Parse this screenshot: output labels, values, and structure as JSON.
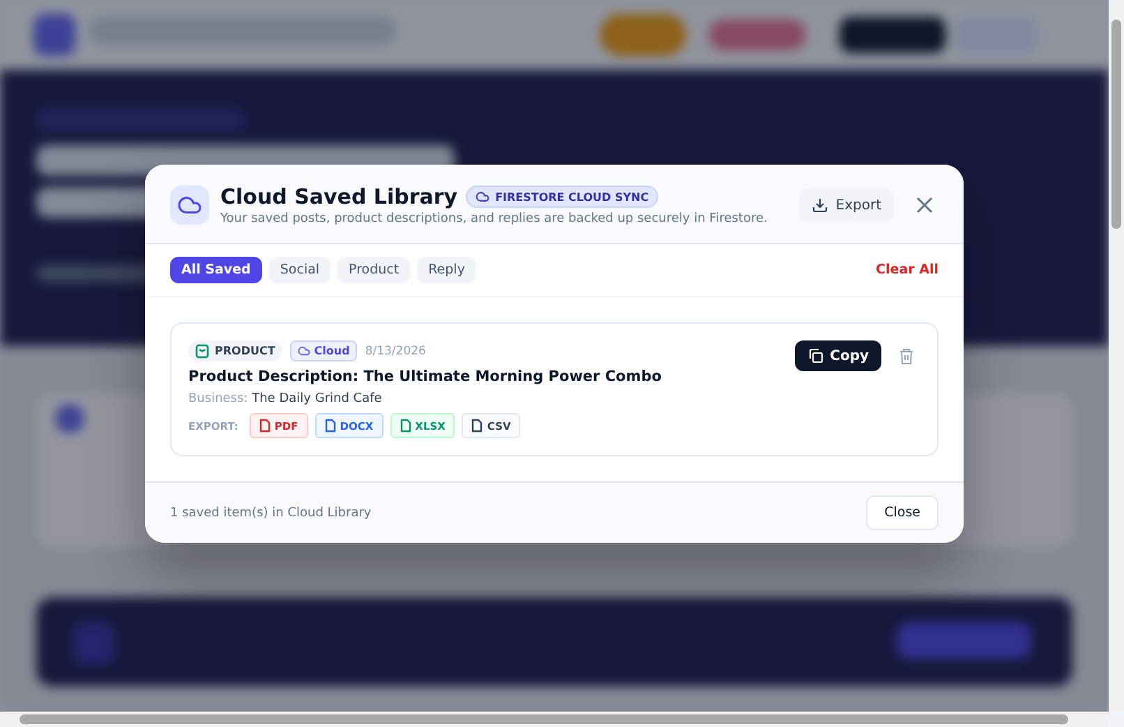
{
  "dialog": {
    "title": "Cloud Saved Library",
    "sync_badge": "FIRESTORE CLOUD SYNC",
    "subtitle": "Your saved posts, product descriptions, and replies are backed up securely in Firestore.",
    "export_button": "Export",
    "filters": [
      {
        "label": "All Saved",
        "selected": true
      },
      {
        "label": "Social",
        "selected": false
      },
      {
        "label": "Product",
        "selected": false
      },
      {
        "label": "Reply",
        "selected": false
      }
    ],
    "clear_all": "Clear All",
    "items": [
      {
        "type_tag": "PRODUCT",
        "storage_tag": "Cloud",
        "date": "8/13/2026",
        "title": "Product Description: The Ultimate Morning Power Combo",
        "business_label": "Business:",
        "business": "The Daily Grind Cafe",
        "export_label": "EXPORT:",
        "copy_button": "Copy",
        "formats": [
          {
            "label": "PDF",
            "kind": "pdf"
          },
          {
            "label": "DOCX",
            "kind": "docx"
          },
          {
            "label": "XLSX",
            "kind": "xlsx"
          },
          {
            "label": "CSV",
            "kind": "csv"
          }
        ]
      }
    ],
    "footer_text": "1 saved item(s) in Cloud Library",
    "close_button": "Close"
  }
}
